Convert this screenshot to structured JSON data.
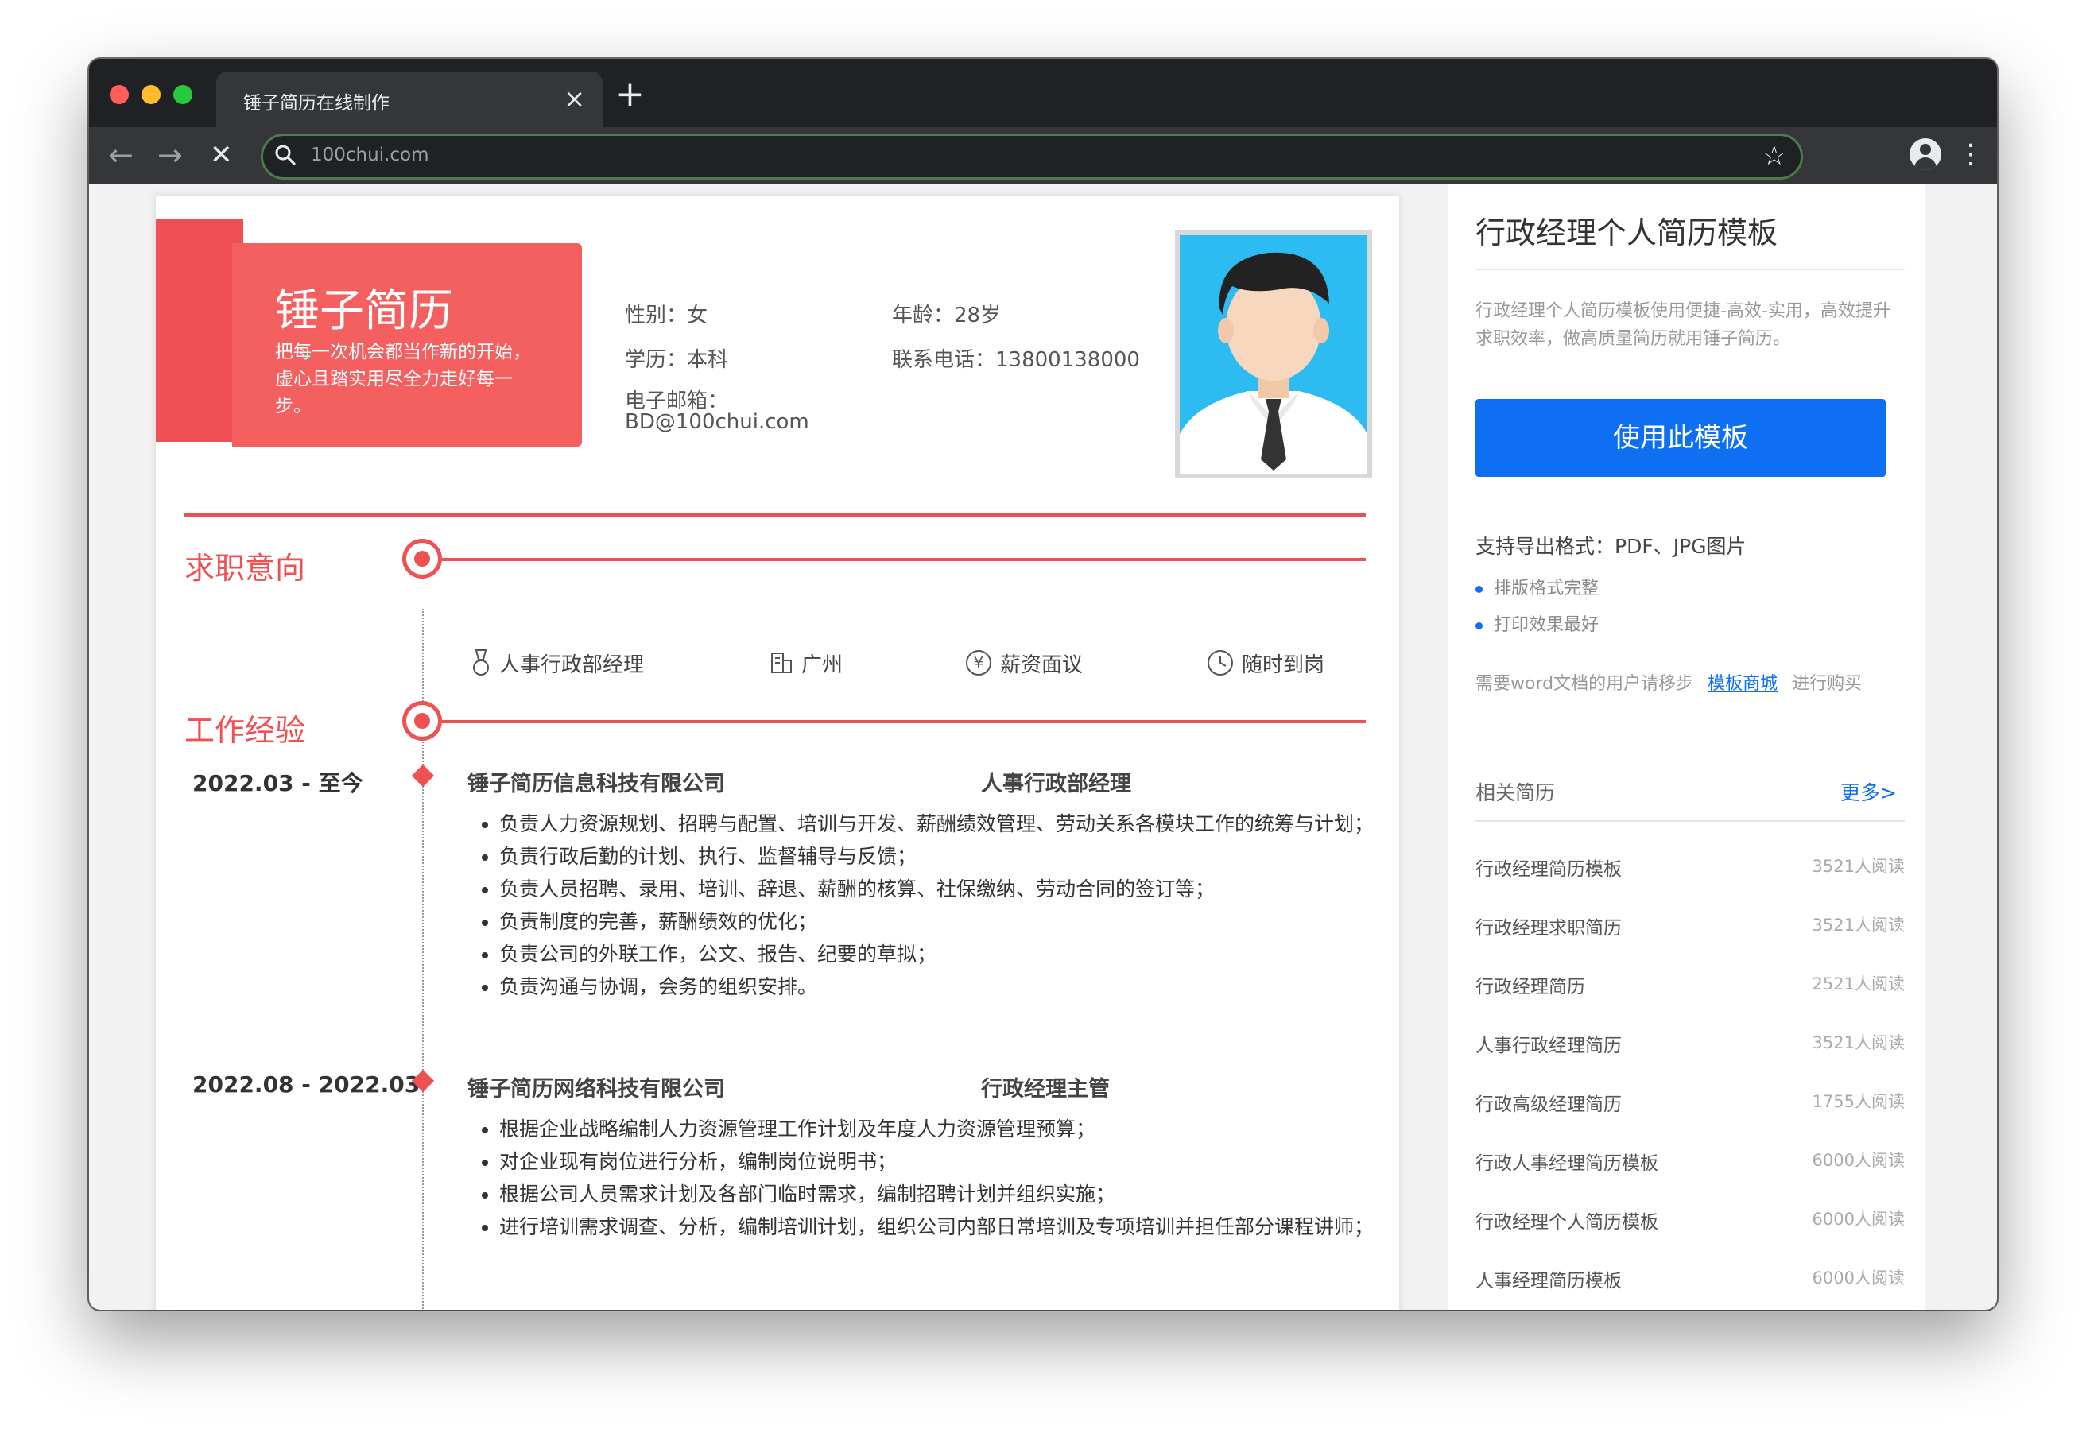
{
  "browser": {
    "tab_title": "锤子简历在线制作",
    "tab_close": "×",
    "new_tab": "+",
    "url": "100chui.com"
  },
  "resume": {
    "brand": "锤子简历",
    "slogan": "把每一次机会都当作新的开始，虚心且踏实用尽全力走好每一步。",
    "info": {
      "gender": "性别：女",
      "age": "年龄：28岁",
      "education": "学历：本科",
      "phone": "联系电话：13800138000",
      "email_label": "电子邮箱：",
      "email": "BD@100chui.com"
    },
    "sections": {
      "intent": "求职意向",
      "experience": "工作经验"
    },
    "intent_items": [
      {
        "label": "人事行政部经理",
        "icon": "medal-icon"
      },
      {
        "label": "广州",
        "icon": "building-icon"
      },
      {
        "label": "薪资面议",
        "icon": "yuan-icon"
      },
      {
        "label": "随时到岗",
        "icon": "clock-icon"
      }
    ],
    "experience": [
      {
        "date": "2022.03 - 至今",
        "company": "锤子简历信息科技有限公司",
        "role": "人事行政部经理",
        "bullets": [
          "负责人力资源规划、招聘与配置、培训与开发、薪酬绩效管理、劳动关系各模块工作的统筹与计划；",
          "负责行政后勤的计划、执行、监督辅导与反馈；",
          "负责人员招聘、录用、培训、辞退、薪酬的核算、社保缴纳、劳动合同的签订等；",
          "负责制度的完善，薪酬绩效的优化；",
          "负责公司的外联工作，公文、报告、纪要的草拟；",
          "负责沟通与协调，会务的组织安排。"
        ]
      },
      {
        "date": "2022.08 - 2022.03",
        "company": "锤子简历网络科技有限公司",
        "role": "行政经理主管",
        "bullets": [
          "根据企业战略编制人力资源管理工作计划及年度人力资源管理预算；",
          "对企业现有岗位进行分析，编制岗位说明书；",
          "根据公司人员需求计划及各部门临时需求，编制招聘计划并组织实施；",
          "进行培训需求调查、分析，编制培训计划，组织公司内部日常培训及专项培训并担任部分课程讲师；"
        ]
      }
    ]
  },
  "sidebar": {
    "title": "行政经理个人简历模板",
    "desc": "行政经理个人简历模板使用便捷-高效-实用，高效提升求职效率，做高质量简历就用锤子简历。",
    "use_button": "使用此模板",
    "export_formats": "支持导出格式：PDF、JPG图片",
    "features": [
      "排版格式完整",
      "打印效果最好"
    ],
    "word_pre": "需要word文档的用户请移步",
    "word_link": "模板商城",
    "word_post": "进行购买",
    "related_title": "相关简历",
    "more": "更多>",
    "related": [
      {
        "name": "行政经理简历模板",
        "count": "3521人阅读"
      },
      {
        "name": "行政经理求职简历",
        "count": "3521人阅读"
      },
      {
        "name": "行政经理简历",
        "count": "2521人阅读"
      },
      {
        "name": "人事行政经理简历",
        "count": "3521人阅读"
      },
      {
        "name": "行政高级经理简历",
        "count": "1755人阅读"
      },
      {
        "name": "行政人事经理简历模板",
        "count": "6000人阅读"
      },
      {
        "name": "行政经理个人简历模板",
        "count": "6000人阅读"
      },
      {
        "name": "人事经理简历模板",
        "count": "6000人阅读"
      }
    ]
  },
  "colors": {
    "accent_red": "#ef5054",
    "primary_blue": "#0f6ff2",
    "chrome_dark": "#202124"
  }
}
